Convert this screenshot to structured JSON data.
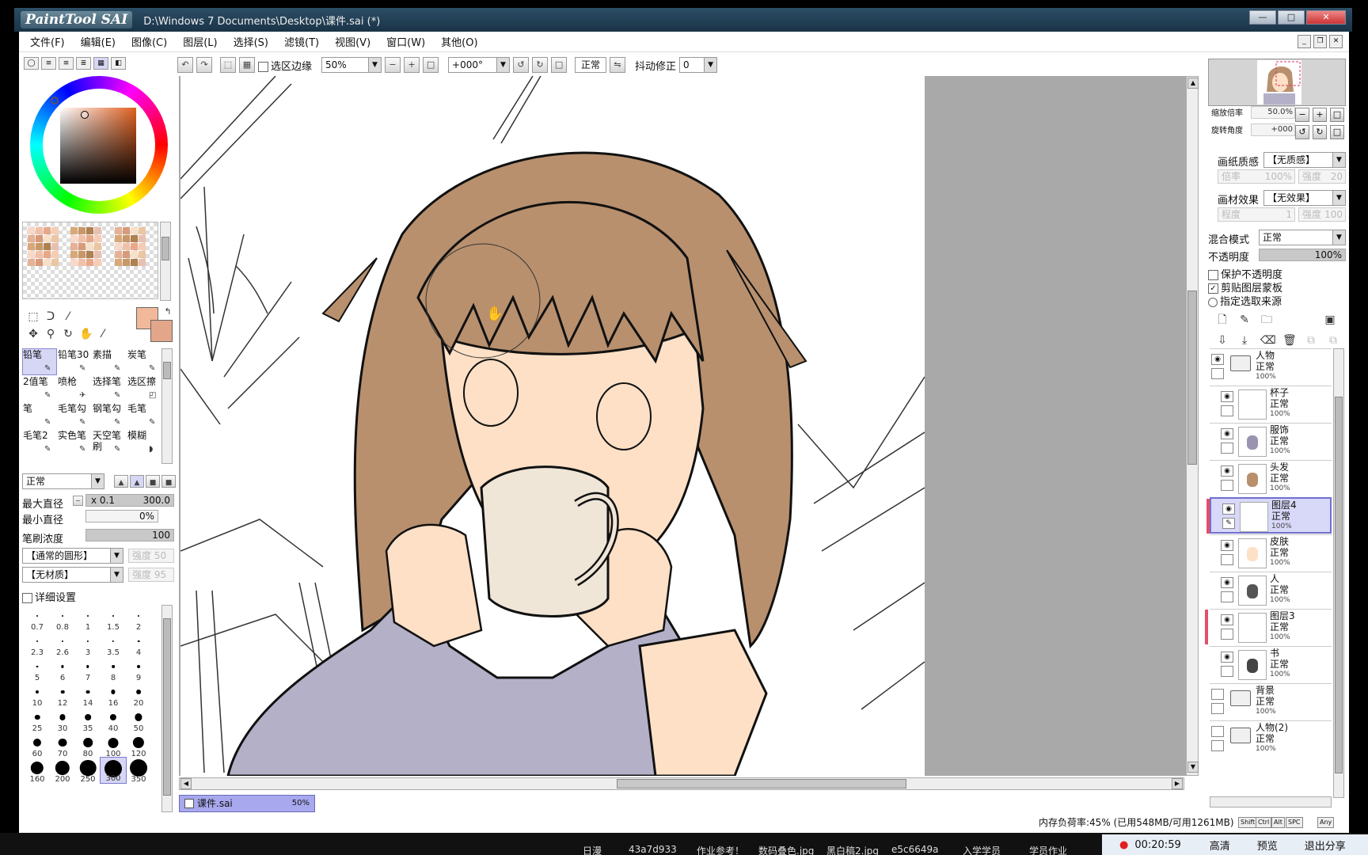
{
  "window": {
    "logo": "PaintTool SAI",
    "title": "D:\\Windows 7 Documents\\Desktop\\课件.sai (*)"
  },
  "menu": [
    "文件(F)",
    "编辑(E)",
    "图像(C)",
    "图层(L)",
    "选择(S)",
    "滤镜(T)",
    "视图(V)",
    "窗口(W)",
    "其他(O)"
  ],
  "toolbar": {
    "select_edge_label": "选区边缘",
    "zoom": "50%",
    "rotation": "+000°",
    "blend": "正常",
    "stabilizer_label": "抖动修正",
    "stabilizer_value": "0"
  },
  "left": {
    "brushes": [
      "铅笔",
      "铅笔30",
      "素描",
      "炭笔",
      "2值笔",
      "喷枪",
      "选择笔",
      "选区擦",
      "笔",
      "毛笔勾",
      "钢笔勾",
      "毛笔",
      "毛笔2",
      "实色笔",
      "天空笔刷",
      "模糊"
    ],
    "brush_mode": "正常",
    "max_size_label": "最大直径",
    "max_size_mult": "x 0.1",
    "max_size_value": "300.0",
    "min_size_label": "最小直径",
    "min_size_value": "0%",
    "density_label": "笔刷浓度",
    "density_value": "100",
    "shape": "【通常的圆形】",
    "shape_strength": "强度 50",
    "texture": "【无材质】",
    "texture_strength": "强度 95",
    "detail_label": "详细设置",
    "sizes": [
      "0.7",
      "0.8",
      "1",
      "1.5",
      "2",
      "2.3",
      "2.6",
      "3",
      "3.5",
      "4",
      "5",
      "6",
      "7",
      "8",
      "9",
      "10",
      "12",
      "14",
      "16",
      "20",
      "25",
      "30",
      "35",
      "40",
      "50",
      "60",
      "70",
      "80",
      "100",
      "120",
      "160",
      "200",
      "250",
      "300",
      "350"
    ]
  },
  "right": {
    "zoom_label": "缩放倍率",
    "zoom_value": "50.0%",
    "angle_label": "旋转角度",
    "angle_value": "+000",
    "paper_label": "画纸质感",
    "paper_value": "【无质感】",
    "paper_rate": "倍率",
    "paper_rate_val": "100%",
    "paper_strength": "强度",
    "paper_strength_val": "20",
    "effect_label": "画材效果",
    "effect_value": "【无效果】",
    "effect_degree": "程度",
    "effect_degree_val": "1",
    "effect_strength": "强度",
    "effect_strength_val": "100",
    "blend_label": "混合模式",
    "blend_value": "正常",
    "opacity_label": "不透明度",
    "opacity_value": "100%",
    "protect_opacity": "保护不透明度",
    "clip_mask": "剪贴图层蒙板",
    "selection_source": "指定选取来源"
  },
  "layers": [
    {
      "name": "人物",
      "mode": "正常",
      "opacity": "100%",
      "type": "folder"
    },
    {
      "name": "杯子",
      "mode": "正常",
      "opacity": "100%",
      "type": "layer"
    },
    {
      "name": "服饰",
      "mode": "正常",
      "opacity": "100%",
      "type": "layer"
    },
    {
      "name": "头发",
      "mode": "正常",
      "opacity": "100%",
      "type": "layer"
    },
    {
      "name": "图层4",
      "mode": "正常",
      "opacity": "100%",
      "type": "layer",
      "active": true
    },
    {
      "name": "皮肤",
      "mode": "正常",
      "opacity": "100%",
      "type": "layer"
    },
    {
      "name": "人",
      "mode": "正常",
      "opacity": "100%",
      "type": "layer"
    },
    {
      "name": "图层3",
      "mode": "正常",
      "opacity": "100%",
      "type": "layer"
    },
    {
      "name": "书",
      "mode": "正常",
      "opacity": "100%",
      "type": "layer"
    },
    {
      "name": "背景",
      "mode": "正常",
      "opacity": "100%",
      "type": "folder"
    },
    {
      "name": "人物(2)",
      "mode": "正常",
      "opacity": "100%",
      "type": "folder"
    }
  ],
  "document_tab": {
    "name": "课件.sai",
    "zoom": "50%"
  },
  "status": {
    "memory": "内存负荷率:45% (已用548MB/可用1261MB)",
    "keys": [
      "Shift",
      "Ctrl",
      "Alt",
      "SPC",
      "Any"
    ]
  },
  "taskbar": {
    "items": [
      "日漫",
      "43a7d933",
      "作业参考！",
      "数码叠色.jpg",
      "黑白稿2.jpg",
      "e5c6649a",
      "入学学员",
      "学员作业"
    ]
  },
  "recorder": {
    "time": "00:20:59",
    "hd": "高清",
    "preview": "预览",
    "exit": "退出分享"
  },
  "colors": {
    "primary": "#f2b89a",
    "secondary": "#e3a68a",
    "hair": "#b8906e",
    "skin": "#fde0c6",
    "sweater": "#b3b0c8",
    "cup": "#efe6d8",
    "accent": "#a8a8ee"
  }
}
